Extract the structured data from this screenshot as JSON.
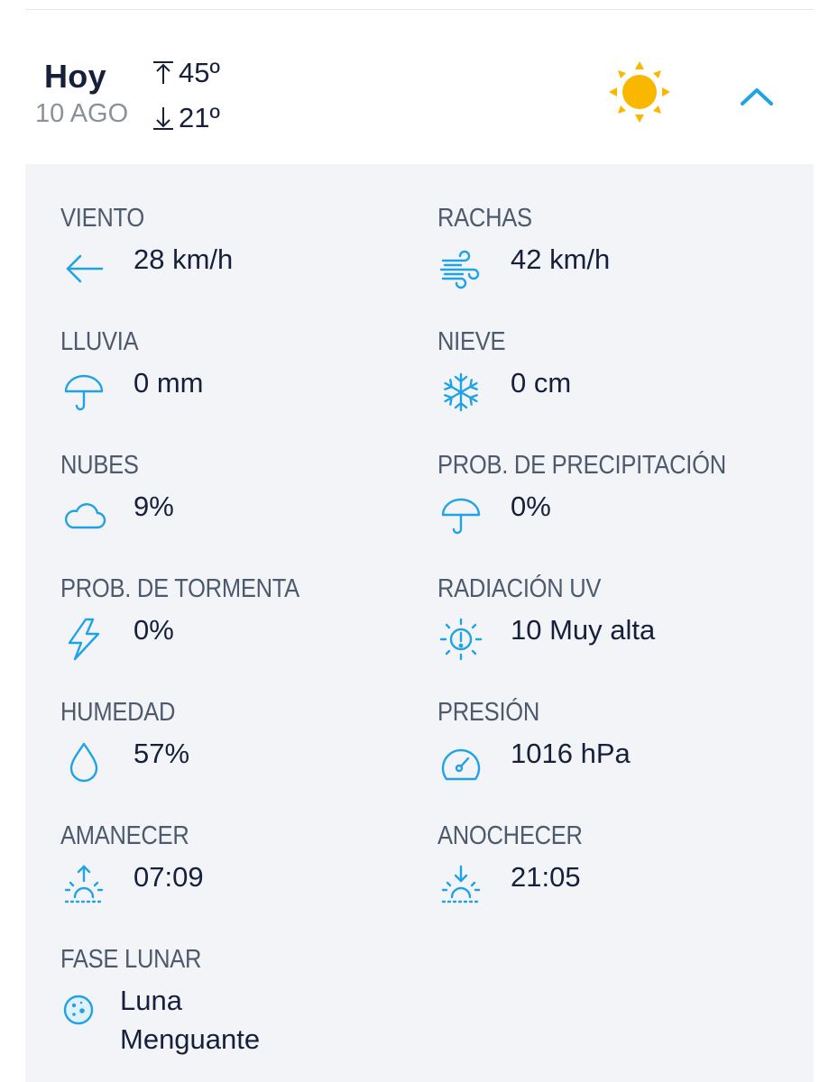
{
  "header": {
    "day": "Hoy",
    "date": "10 AGO",
    "temp_max": "45º",
    "temp_min": "21º",
    "weather_icon": "sun-icon",
    "toggle_icon": "chevron-up-icon"
  },
  "colors": {
    "accent": "#1fa3e6",
    "sun": "#f9b700",
    "panel_bg": "#f2f4f7",
    "label": "#4d5a6d",
    "text": "#16203a"
  },
  "details": {
    "wind": {
      "label": "VIENTO",
      "value": "28 km/h",
      "icon": "arrow-left-icon"
    },
    "gusts": {
      "label": "RACHAS",
      "value": "42 km/h",
      "icon": "wind-gust-icon"
    },
    "rain": {
      "label": "LLUVIA",
      "value": "0 mm",
      "icon": "umbrella-icon"
    },
    "snow": {
      "label": "NIEVE",
      "value": "0 cm",
      "icon": "snowflake-icon"
    },
    "clouds": {
      "label": "NUBES",
      "value": "9%",
      "icon": "cloud-icon"
    },
    "precip_prob": {
      "label": "PROB. DE PRECIPITACIÓN",
      "value": "0%",
      "icon": "umbrella-icon"
    },
    "storm_prob": {
      "label": "PROB. DE TORMENTA",
      "value": "0%",
      "icon": "lightning-icon"
    },
    "uv": {
      "label": "RADIACIÓN UV",
      "value": "10 Muy alta",
      "icon": "uv-sun-icon"
    },
    "humidity": {
      "label": "HUMEDAD",
      "value": "57%",
      "icon": "droplet-icon"
    },
    "pressure": {
      "label": "PRESIÓN",
      "value": "1016 hPa",
      "icon": "gauge-icon"
    },
    "sunrise": {
      "label": "AMANECER",
      "value": "07:09",
      "icon": "sunrise-icon"
    },
    "sunset": {
      "label": "ANOCHECER",
      "value": "21:05",
      "icon": "sunset-icon"
    },
    "moon": {
      "label": "FASE LUNAR",
      "value": "Luna Menguante",
      "icon": "moon-icon"
    }
  }
}
